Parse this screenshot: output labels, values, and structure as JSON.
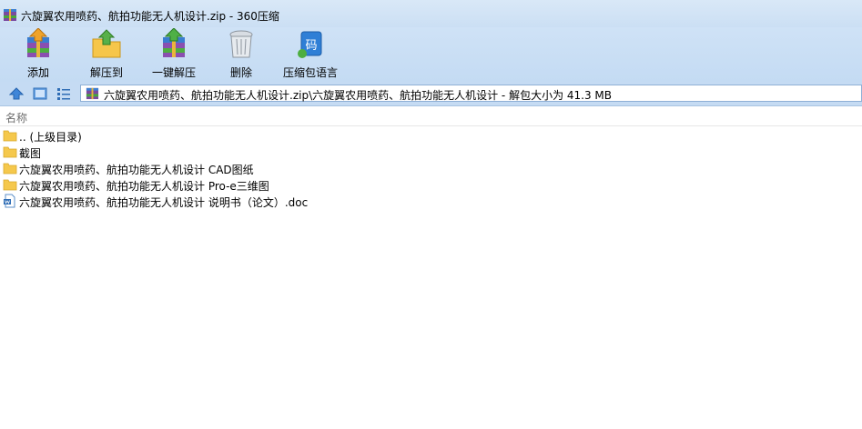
{
  "window": {
    "title": "六旋翼农用喷药、航拍功能无人机设计.zip - 360压缩"
  },
  "toolbar": {
    "buttons": [
      {
        "label": "添加",
        "icon": "add-archive-icon"
      },
      {
        "label": "解压到",
        "icon": "extract-to-icon"
      },
      {
        "label": "一键解压",
        "icon": "one-click-extract-icon"
      },
      {
        "label": "删除",
        "icon": "trash-icon"
      },
      {
        "label": "压缩包语言",
        "icon": "encoding-icon",
        "icon_text": "码"
      }
    ]
  },
  "address": {
    "path": "六旋翼农用喷药、航拍功能无人机设计.zip\\六旋翼农用喷药、航拍功能无人机设计 - 解包大小为 41.3 MB"
  },
  "list": {
    "column_name": "名称",
    "items": [
      {
        "name": ".. (上级目录)",
        "type": "folder"
      },
      {
        "name": "截图",
        "type": "folder"
      },
      {
        "name": "六旋翼农用喷药、航拍功能无人机设计 CAD图纸",
        "type": "folder"
      },
      {
        "name": "六旋翼农用喷药、航拍功能无人机设计 Pro-e三维图",
        "type": "folder"
      },
      {
        "name": "六旋翼农用喷药、航拍功能无人机设计 说明书（论文）.doc",
        "type": "doc"
      }
    ]
  },
  "colors": {
    "toolbar_bg": "#c9def4",
    "folder": "#f5c84c",
    "accent": "#2f7fd6"
  }
}
